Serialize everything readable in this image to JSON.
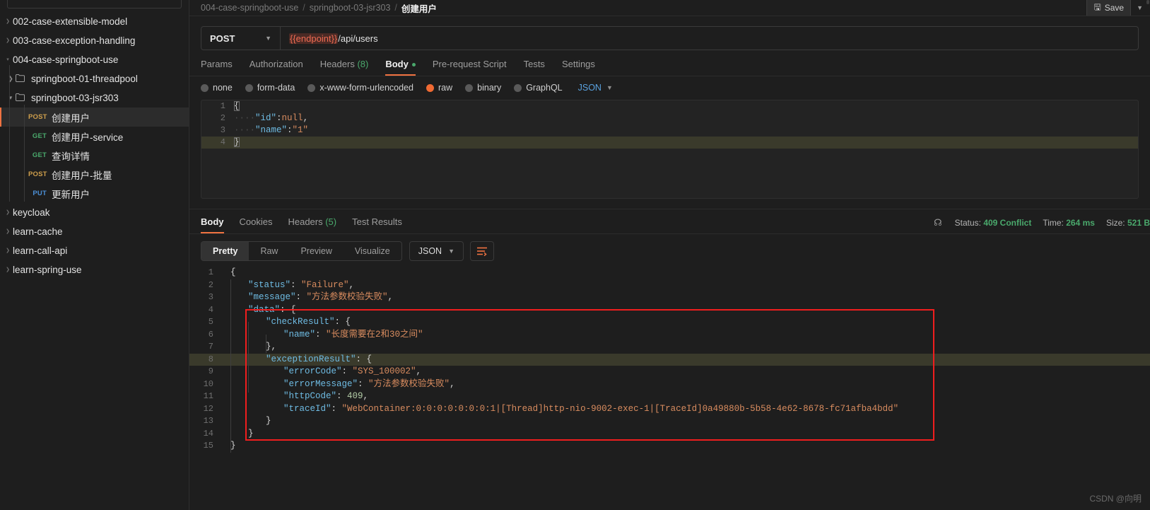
{
  "sidebar": {
    "search_placeholder": "",
    "items": [
      {
        "label": "002-case-extensible-model",
        "type": "collection",
        "caret": "collapsed",
        "indent": 1
      },
      {
        "label": "003-case-exception-handling",
        "type": "collection",
        "caret": "collapsed",
        "indent": 1
      },
      {
        "label": "004-case-springboot-use",
        "type": "collection",
        "caret": "expanded",
        "indent": 1
      },
      {
        "label": "springboot-01-threadpool",
        "type": "folder",
        "caret": "collapsed",
        "indent": 2
      },
      {
        "label": "springboot-03-jsr303",
        "type": "folder",
        "caret": "expanded",
        "indent": 2
      },
      {
        "label": "创建用户",
        "type": "request",
        "method": "POST",
        "indent": 3,
        "selected": true
      },
      {
        "label": "创建用户-service",
        "type": "request",
        "method": "GET",
        "indent": 3
      },
      {
        "label": "查询详情",
        "type": "request",
        "method": "GET",
        "indent": 3
      },
      {
        "label": "创建用户-批量",
        "type": "request",
        "method": "POST",
        "indent": 3
      },
      {
        "label": "更新用户",
        "type": "request",
        "method": "PUT",
        "indent": 3
      },
      {
        "label": "keycloak",
        "type": "collection",
        "caret": "collapsed",
        "indent": 1
      },
      {
        "label": "learn-cache",
        "type": "collection",
        "caret": "collapsed",
        "indent": 1
      },
      {
        "label": "learn-call-api",
        "type": "collection",
        "caret": "collapsed",
        "indent": 1
      },
      {
        "label": "learn-spring-use",
        "type": "collection",
        "caret": "collapsed",
        "indent": 1
      }
    ]
  },
  "breadcrumb": {
    "part1": "004-case-springboot-use",
    "sep": "/",
    "part2": "springboot-03-jsr303",
    "current": "创建用户",
    "save_label": "Save"
  },
  "request": {
    "method": "POST",
    "url_variable": "{{endpoint}}",
    "url_path": "/api/users",
    "tabs": [
      {
        "label": "Params",
        "active": false
      },
      {
        "label": "Authorization",
        "active": false
      },
      {
        "label": "Headers",
        "count": "(8)",
        "active": false
      },
      {
        "label": "Body",
        "active": true,
        "dot": true
      },
      {
        "label": "Pre-request Script",
        "active": false
      },
      {
        "label": "Tests",
        "active": false
      },
      {
        "label": "Settings",
        "active": false
      }
    ],
    "body_types": [
      {
        "label": "none",
        "checked": false
      },
      {
        "label": "form-data",
        "checked": false
      },
      {
        "label": "x-www-form-urlencoded",
        "checked": false
      },
      {
        "label": "raw",
        "checked": true
      },
      {
        "label": "binary",
        "checked": false
      },
      {
        "label": "GraphQL",
        "checked": false
      }
    ],
    "format": "JSON",
    "body_lines": [
      {
        "n": "1",
        "tokens": [
          {
            "t": "{",
            "c": "c-brace"
          }
        ]
      },
      {
        "n": "2",
        "tokens": [
          {
            "t": "····",
            "c": "c-dots"
          },
          {
            "t": "\"id\"",
            "c": "c-key"
          },
          {
            "t": ":",
            "c": "c-punc"
          },
          {
            "t": "null",
            "c": "c-null"
          },
          {
            "t": ",",
            "c": "c-punc"
          }
        ]
      },
      {
        "n": "3",
        "tokens": [
          {
            "t": "····",
            "c": "c-dots"
          },
          {
            "t": "\"name\"",
            "c": "c-key"
          },
          {
            "t": ":",
            "c": "c-punc"
          },
          {
            "t": "\"1\"",
            "c": "c-str"
          }
        ]
      },
      {
        "n": "4",
        "highlight": true,
        "tokens": [
          {
            "t": "}",
            "c": "c-brace"
          }
        ]
      }
    ]
  },
  "response": {
    "tabs": [
      {
        "label": "Body",
        "active": true
      },
      {
        "label": "Cookies",
        "active": false
      },
      {
        "label": "Headers",
        "count": "(5)",
        "active": false
      },
      {
        "label": "Test Results",
        "active": false
      }
    ],
    "meta": {
      "globe_icon": "globe-icon",
      "status_label": "Status:",
      "status_value": "409 Conflict",
      "time_label": "Time:",
      "time_value": "264 ms",
      "size_label": "Size:",
      "size_value": "521 B"
    },
    "views": [
      {
        "label": "Pretty",
        "active": true
      },
      {
        "label": "Raw",
        "active": false
      },
      {
        "label": "Preview",
        "active": false
      },
      {
        "label": "Visualize",
        "active": false
      }
    ],
    "format": "JSON",
    "body_lines": [
      {
        "n": "1",
        "indent": 0,
        "tokens": [
          {
            "t": "{",
            "c": "r-brace"
          }
        ]
      },
      {
        "n": "2",
        "indent": 1,
        "tokens": [
          {
            "t": "\"status\"",
            "c": "r-key"
          },
          {
            "t": ": ",
            "c": "r-punc"
          },
          {
            "t": "\"Failure\"",
            "c": "r-str"
          },
          {
            "t": ",",
            "c": "r-punc"
          }
        ]
      },
      {
        "n": "3",
        "indent": 1,
        "tokens": [
          {
            "t": "\"message\"",
            "c": "r-key"
          },
          {
            "t": ": ",
            "c": "r-punc"
          },
          {
            "t": "\"方法参数校验失败\"",
            "c": "r-str"
          },
          {
            "t": ",",
            "c": "r-punc"
          }
        ]
      },
      {
        "n": "4",
        "indent": 1,
        "tokens": [
          {
            "t": "\"data\"",
            "c": "r-key"
          },
          {
            "t": ": ",
            "c": "r-punc"
          },
          {
            "t": "{",
            "c": "r-brace"
          }
        ]
      },
      {
        "n": "5",
        "indent": 2,
        "tokens": [
          {
            "t": "\"checkResult\"",
            "c": "r-key"
          },
          {
            "t": ": ",
            "c": "r-punc"
          },
          {
            "t": "{",
            "c": "r-brace"
          }
        ]
      },
      {
        "n": "6",
        "indent": 3,
        "tokens": [
          {
            "t": "\"name\"",
            "c": "r-key"
          },
          {
            "t": ": ",
            "c": "r-punc"
          },
          {
            "t": "\"长度需要在2和30之间\"",
            "c": "r-str"
          }
        ]
      },
      {
        "n": "7",
        "indent": 2,
        "tokens": [
          {
            "t": "}",
            "c": "r-brace"
          },
          {
            "t": ",",
            "c": "r-punc"
          }
        ]
      },
      {
        "n": "8",
        "indent": 2,
        "highlight": true,
        "tokens": [
          {
            "t": "\"exceptionResult\"",
            "c": "r-key"
          },
          {
            "t": ": ",
            "c": "r-punc"
          },
          {
            "t": "{",
            "c": "r-brace"
          }
        ]
      },
      {
        "n": "9",
        "indent": 3,
        "tokens": [
          {
            "t": "\"errorCode\"",
            "c": "r-key"
          },
          {
            "t": ": ",
            "c": "r-punc"
          },
          {
            "t": "\"SYS_100002\"",
            "c": "r-str"
          },
          {
            "t": ",",
            "c": "r-punc"
          }
        ]
      },
      {
        "n": "10",
        "indent": 3,
        "tokens": [
          {
            "t": "\"errorMessage\"",
            "c": "r-key"
          },
          {
            "t": ": ",
            "c": "r-punc"
          },
          {
            "t": "\"方法参数校验失败\"",
            "c": "r-str"
          },
          {
            "t": ",",
            "c": "r-punc"
          }
        ]
      },
      {
        "n": "11",
        "indent": 3,
        "tokens": [
          {
            "t": "\"httpCode\"",
            "c": "r-key"
          },
          {
            "t": ": ",
            "c": "r-punc"
          },
          {
            "t": "409",
            "c": "r-num"
          },
          {
            "t": ",",
            "c": "r-punc"
          }
        ]
      },
      {
        "n": "12",
        "indent": 3,
        "tokens": [
          {
            "t": "\"traceId\"",
            "c": "r-key"
          },
          {
            "t": ": ",
            "c": "r-punc"
          },
          {
            "t": "\"WebContainer:0:0:0:0:0:0:0:1|[Thread]http-nio-9002-exec-1|[TraceId]0a49880b-5b58-4e62-8678-fc71afba4bdd\"",
            "c": "r-str"
          }
        ]
      },
      {
        "n": "13",
        "indent": 2,
        "tokens": [
          {
            "t": "}",
            "c": "r-brace"
          }
        ]
      },
      {
        "n": "14",
        "indent": 1,
        "tokens": [
          {
            "t": "}",
            "c": "r-brace"
          }
        ]
      },
      {
        "n": "15",
        "indent": 0,
        "tokens": [
          {
            "t": "}",
            "c": "r-brace"
          }
        ]
      }
    ]
  },
  "watermark": "CSDN @向明"
}
